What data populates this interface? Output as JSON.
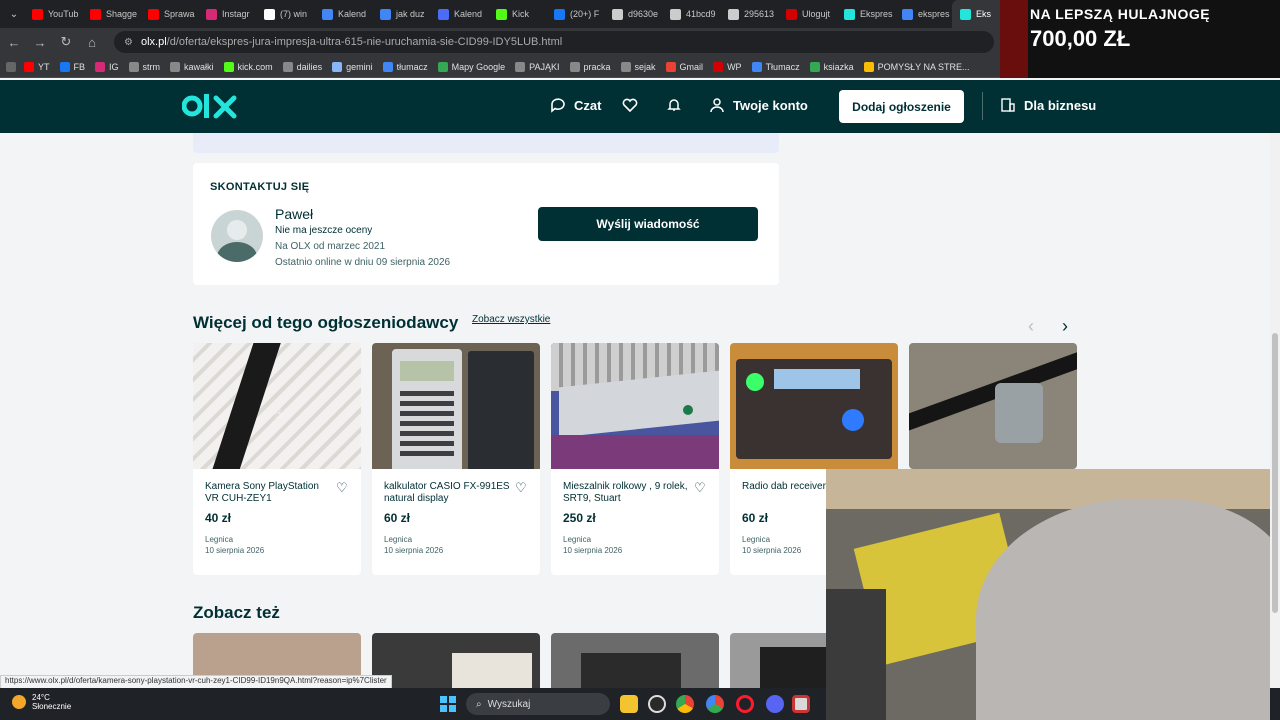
{
  "browser": {
    "tabs": [
      {
        "label": "YouTub",
        "color": "#ff0000"
      },
      {
        "label": "Shagge",
        "color": "#ff0000"
      },
      {
        "label": "Sprawa",
        "color": "#ff0000"
      },
      {
        "label": "Instagr",
        "color": "#d62976"
      },
      {
        "label": "(7) win",
        "color": "#ffffff"
      },
      {
        "label": "Kalend",
        "color": "#4285f4"
      },
      {
        "label": "jak duz",
        "color": "#4285f4"
      },
      {
        "label": "Kalend",
        "color": "#4a6cf7"
      },
      {
        "label": "Kick",
        "color": "#53fc18"
      },
      {
        "label": "(20+) F",
        "color": "#1877f2"
      },
      {
        "label": "d9630e",
        "color": "#cccccc"
      },
      {
        "label": "41bcd9",
        "color": "#cccccc"
      },
      {
        "label": "295613",
        "color": "#cccccc"
      },
      {
        "label": "Ulogujt",
        "color": "#d40000"
      },
      {
        "label": "Ekspres",
        "color": "#23e5db"
      },
      {
        "label": "ekspres",
        "color": "#4285f4"
      },
      {
        "label": "Eks",
        "color": "#23e5db"
      }
    ],
    "url_domain": "olx.pl",
    "url_path": "/d/oferta/ekspres-jura-impresja-ultra-615-nie-uruchamia-sie-CID99-IDY5LUB.html",
    "bookmarks": [
      {
        "label": "YT",
        "color": "#ff0000"
      },
      {
        "label": "FB",
        "color": "#1877f2"
      },
      {
        "label": "IG",
        "color": "#d62976"
      },
      {
        "label": "strm",
        "color": "#888888"
      },
      {
        "label": "kawałki",
        "color": "#888888"
      },
      {
        "label": "kick.com",
        "color": "#53fc18"
      },
      {
        "label": "dailies",
        "color": "#888888"
      },
      {
        "label": "gemini",
        "color": "#8ab4f8"
      },
      {
        "label": "tłumacz",
        "color": "#4285f4"
      },
      {
        "label": "Mapy Google",
        "color": "#34a853"
      },
      {
        "label": "PAJĄKI",
        "color": "#888888"
      },
      {
        "label": "pracka",
        "color": "#888888"
      },
      {
        "label": "sejak",
        "color": "#888888"
      },
      {
        "label": "Gmail",
        "color": "#ea4335"
      },
      {
        "label": "WP",
        "color": "#d40000"
      },
      {
        "label": "Tłumacz",
        "color": "#4285f4"
      },
      {
        "label": "ksiazka",
        "color": "#34a853"
      },
      {
        "label": "POMYSŁY NA STRE...",
        "color": "#fbbc05"
      }
    ]
  },
  "header": {
    "logo": "olx",
    "chat": "Czat",
    "account": "Twoje konto",
    "add_listing": "Dodaj ogłoszenie",
    "business": "Dla biznesu"
  },
  "contact": {
    "title": "SKONTAKTUJ SIĘ",
    "name": "Paweł",
    "rating": "Nie ma jeszcze oceny",
    "since": "Na OLX od marzec 2021",
    "last_online": "Ostatnio online w dniu 09 sierpnia 2026",
    "message_button": "Wyślij wiadomość"
  },
  "more_from_seller": {
    "title": "Więcej od tego ogłoszeniodawcy",
    "see_all": "Zobacz wszystkie",
    "items": [
      {
        "title": "Kamera Sony PlayStation VR CUH-ZEY1",
        "price": "40 zł",
        "location": "Legnica",
        "date": "10 sierpnia 2026"
      },
      {
        "title": "kalkulator CASIO FX-991ES natural display",
        "price": "60 zł",
        "location": "Legnica",
        "date": "10 sierpnia 2026"
      },
      {
        "title": "Mieszalnik rolkowy , 9 rolek, SRT9, Stuart",
        "price": "250 zł",
        "location": "Legnica",
        "date": "10 sierpnia 2026"
      },
      {
        "title": "Radio dab receiver Fm",
        "price": "60 zł",
        "location": "Legnica",
        "date": "10 sierpnia 2026"
      }
    ]
  },
  "see_also": {
    "title": "Zobacz też"
  },
  "status_url": "https://www.olx.pl/d/oferta/kamera-sony-playstation-vr-cuh-zey1-CID99-ID19n9QA.html?reason=ip%7Clister",
  "taskbar": {
    "temp": "24°C",
    "weather": "Słonecznie",
    "search_placeholder": "Wyszukaj"
  },
  "overlay": {
    "line1": "NA LEPSZĄ HULAJNOGĘ",
    "line2": "700,00 ZŁ"
  },
  "colors": {
    "olx_dark": "#002f34",
    "olx_teal": "#23e5db"
  }
}
